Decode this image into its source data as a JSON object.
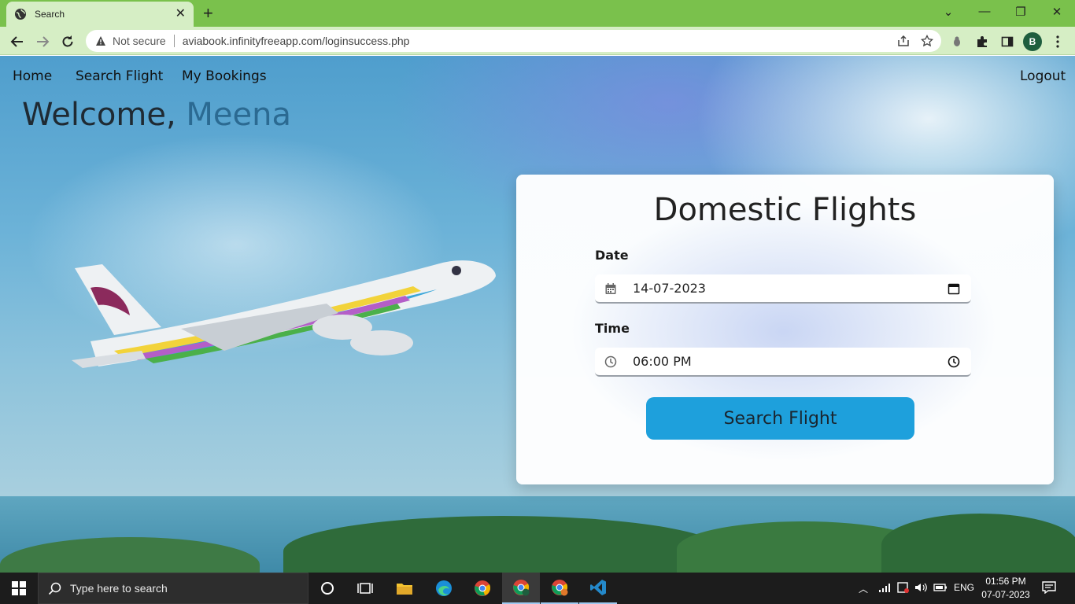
{
  "browser": {
    "tab_title": "Search",
    "security_label": "Not secure",
    "url": "aviabook.infinityfreeapp.com/loginsuccess.php",
    "profile_initial": "B"
  },
  "nav": {
    "home": "Home",
    "search_flight": "Search Flight",
    "my_bookings": "My Bookings",
    "logout": "Logout"
  },
  "welcome": {
    "greeting": "Welcome,",
    "name": "Meena"
  },
  "form": {
    "title": "Domestic Flights",
    "date_label": "Date",
    "date_value": "14-07-2023",
    "time_label": "Time",
    "time_value": "06:00 PM",
    "submit_label": "Search Flight"
  },
  "taskbar": {
    "search_placeholder": "Type here to search",
    "language": "ENG",
    "time": "01:56 PM",
    "date": "07-07-2023"
  },
  "colors": {
    "tabbar": "#7ac14c",
    "toolbar": "#d6eec5",
    "button": "#1ea0dc",
    "welcome_name": "#2b6a92"
  }
}
